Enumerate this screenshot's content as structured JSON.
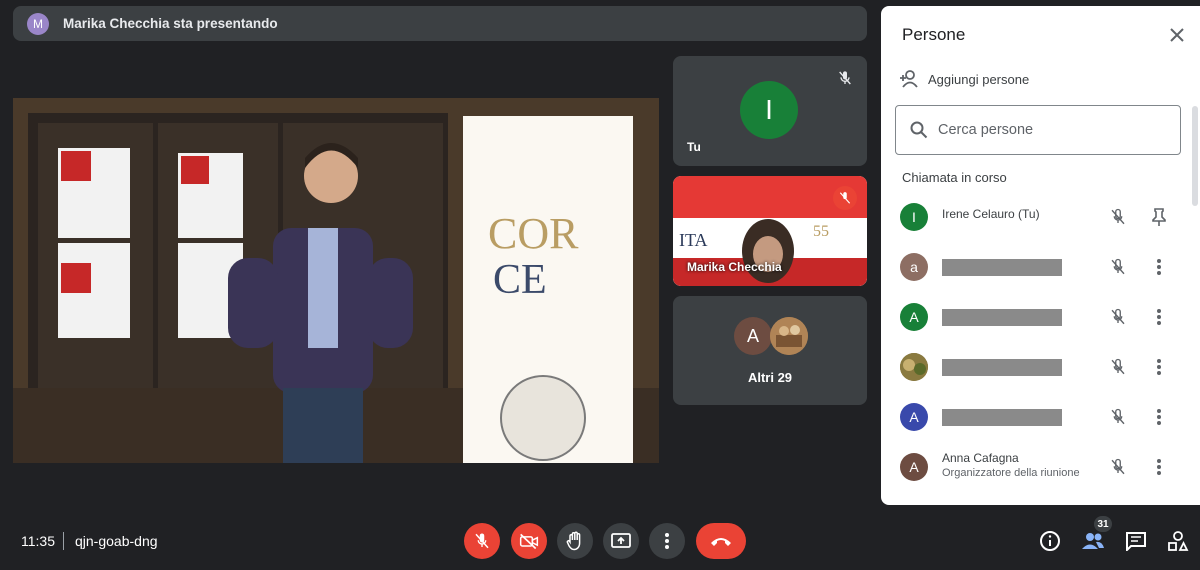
{
  "banner": {
    "avatar_letter": "M",
    "text": "Marika Checchia sta presentando"
  },
  "tiles": {
    "you": {
      "avatar_letter": "I",
      "name": "Tu"
    },
    "speaker": {
      "name": "Marika Checchia"
    },
    "others": {
      "avatar_letter": "A",
      "label": "Altri 29"
    }
  },
  "panel": {
    "title": "Persone",
    "add_label": "Aggiungi persone",
    "search_placeholder": "Cerca persone",
    "section": "Chiamata in corso",
    "people": [
      {
        "letter": "I",
        "name": "Irene Celauro (Tu)",
        "subtitle": "",
        "color": "#188038",
        "action": "pin"
      },
      {
        "letter": "a",
        "name": "",
        "subtitle": "",
        "color": "#8d6e63",
        "action": "more"
      },
      {
        "letter": "A",
        "name": "",
        "subtitle": "",
        "color": "#188038",
        "action": "more"
      },
      {
        "letter": "",
        "name": "",
        "subtitle": "",
        "color": "#7a6a3a",
        "action": "more"
      },
      {
        "letter": "A",
        "name": "",
        "subtitle": "",
        "color": "#3949ab",
        "action": "more"
      },
      {
        "letter": "A",
        "name": "Anna Cafagna",
        "subtitle": "Organizzatore della riunione",
        "color": "#6d4c41",
        "action": "more"
      }
    ]
  },
  "bottom": {
    "time": "11:35",
    "meeting_code": "qjn-goab-dng",
    "people_count": "31"
  },
  "colors": {
    "accent_red": "#ea4335",
    "background": "#202124",
    "tile": "#3c4043"
  }
}
